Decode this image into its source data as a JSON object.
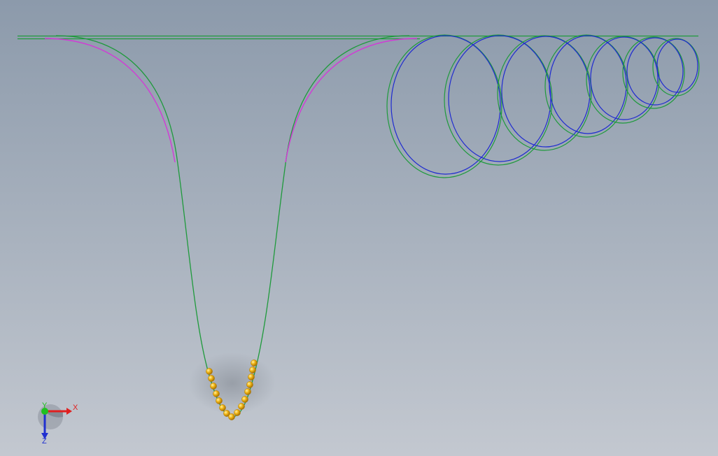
{
  "viewport": {
    "background_top": "#8c9aab",
    "background_bottom": "#c3c8d0"
  },
  "colors": {
    "track": "#1f9a3c",
    "arc_highlight": "#d23ad6",
    "helix": "#1f2bd0",
    "ball_fill": "#f2b818",
    "ball_edge": "#b07a05",
    "ball_shadow": "#8a8f98"
  },
  "triad": {
    "x_label": "X",
    "y_label": "Y",
    "z_label": "Z",
    "x_color": "#e02020",
    "y_color": "#20c020",
    "z_color": "#2030d0"
  }
}
